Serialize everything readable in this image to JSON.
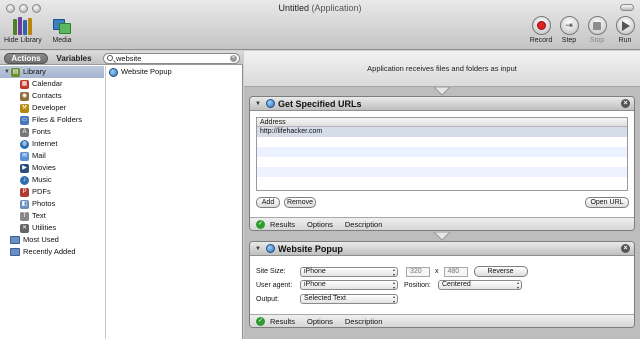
{
  "window": {
    "title": "Untitled",
    "subtitle": "(Application)"
  },
  "toolbar": {
    "hide_library": "Hide Library",
    "media": "Media",
    "record": "Record",
    "step": "Step",
    "stop": "Stop",
    "run": "Run"
  },
  "library": {
    "tab_actions": "Actions",
    "tab_variables": "Variables",
    "search_value": "website",
    "tree": [
      {
        "label": "Library",
        "color": "#6b8e2f",
        "glyph": "▤"
      },
      {
        "label": "Calendar",
        "color": "#c0392b",
        "glyph": "▦"
      },
      {
        "label": "Contacts",
        "color": "#8e6e3a",
        "glyph": "◉"
      },
      {
        "label": "Developer",
        "color": "#b8860b",
        "glyph": "⚒"
      },
      {
        "label": "Files & Folders",
        "color": "#4a78b8",
        "glyph": "▭"
      },
      {
        "label": "Fonts",
        "color": "#777777",
        "glyph": "A"
      },
      {
        "label": "Internet",
        "color": "#2b6db3",
        "glyph": "◍"
      },
      {
        "label": "Mail",
        "color": "#5a8fd1",
        "glyph": "✉"
      },
      {
        "label": "Movies",
        "color": "#2c4f7c",
        "glyph": "▶"
      },
      {
        "label": "Music",
        "color": "#2f6fb1",
        "glyph": "♪"
      },
      {
        "label": "PDFs",
        "color": "#b03a2e",
        "glyph": "P"
      },
      {
        "label": "Photos",
        "color": "#6c8ebf",
        "glyph": "◧"
      },
      {
        "label": "Text",
        "color": "#888888",
        "glyph": "T"
      },
      {
        "label": "Utilities",
        "color": "#666666",
        "glyph": "✕"
      }
    ],
    "most_used": "Most Used",
    "recently_added": "Recently Added",
    "results": [
      "Website Popup"
    ]
  },
  "workflow": {
    "header": "Application receives files and folders as input",
    "action1": {
      "title": "Get Specified URLs",
      "column": "Address",
      "urls": [
        "http://lifehacker.com"
      ],
      "add": "Add",
      "remove": "Remove",
      "open_url": "Open URL"
    },
    "action2": {
      "title": "Website Popup",
      "site_size_label": "Site Size:",
      "site_size_value": "iPhone",
      "width": "320",
      "x": "x",
      "height": "480",
      "reverse": "Reverse",
      "user_agent_label": "User agent:",
      "user_agent_value": "iPhone",
      "position_label": "Position:",
      "position_value": "Centered",
      "output_label": "Output:",
      "output_value": "Selected Text"
    },
    "footer": {
      "results": "Results",
      "options": "Options",
      "description": "Description"
    }
  }
}
